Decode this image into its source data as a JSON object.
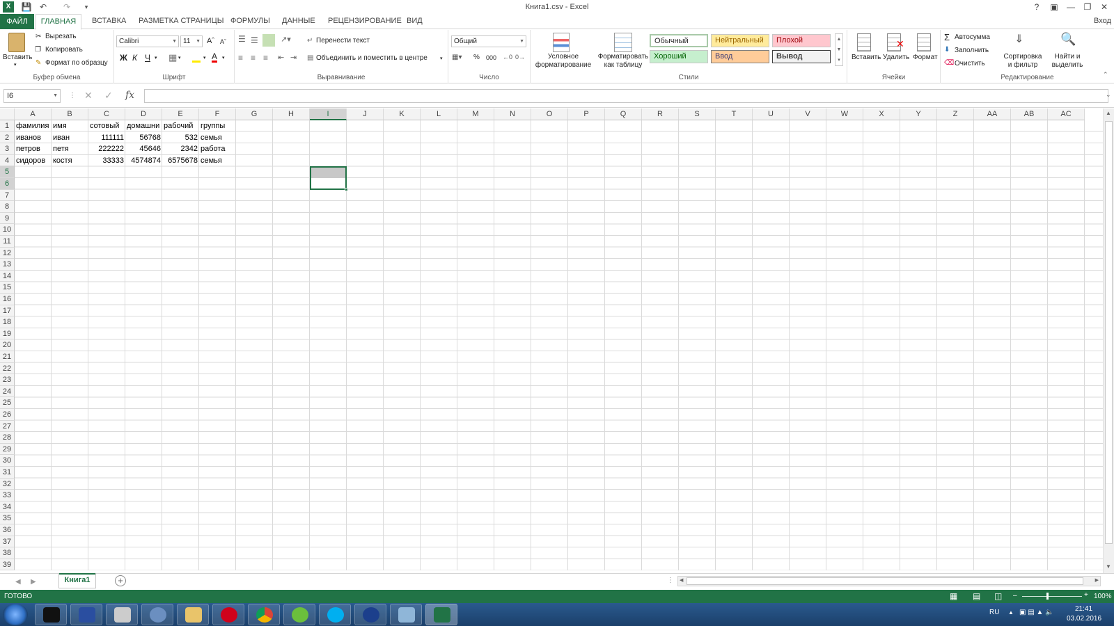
{
  "window": {
    "title": "Книга1.csv - Excel"
  },
  "ribbon_tabs": {
    "file": "ФАЙЛ",
    "items": [
      "ГЛАВНАЯ",
      "ВСТАВКА",
      "РАЗМЕТКА СТРАНИЦЫ",
      "ФОРМУЛЫ",
      "ДАННЫЕ",
      "РЕЦЕНЗИРОВАНИЕ",
      "ВИД"
    ],
    "signin": "Вход"
  },
  "clipboard": {
    "paste": "Вставить",
    "cut": "Вырезать",
    "copy": "Копировать",
    "format_painter": "Формат по образцу",
    "label": "Буфер обмена"
  },
  "font": {
    "name": "Calibri",
    "size": "11",
    "bold": "Ж",
    "italic": "К",
    "underline": "Ч",
    "label": "Шрифт"
  },
  "alignment": {
    "wrap": "Перенести текст",
    "merge": "Объединить и поместить в центре",
    "label": "Выравнивание"
  },
  "number": {
    "format": "Общий",
    "percent": "%",
    "thousands": "000",
    "label": "Число"
  },
  "styles": {
    "conditional": "Условное форматирование",
    "as_table": "Форматировать как таблицу",
    "label": "Стили",
    "normal": "Обычный",
    "neutral": "Нейтральный",
    "bad": "Плохой",
    "good": "Хороший",
    "input": "Ввод",
    "output": "Вывод"
  },
  "cells": {
    "insert": "Вставить",
    "delete": "Удалить",
    "format": "Формат",
    "label": "Ячейки"
  },
  "editing": {
    "autosum": "Автосумма",
    "fill": "Заполнить",
    "clear": "Очистить",
    "sort": "Сортировка и фильтр",
    "find": "Найти и выделить",
    "label": "Редактирование"
  },
  "formula_bar": {
    "name_box": "I6",
    "fx": "fx",
    "value": ""
  },
  "grid": {
    "columns": [
      "A",
      "B",
      "C",
      "D",
      "E",
      "F",
      "G",
      "H",
      "I",
      "J",
      "K",
      "L",
      "M",
      "N",
      "O",
      "P",
      "Q",
      "R",
      "S",
      "T",
      "U",
      "V",
      "W",
      "X",
      "Y",
      "Z",
      "AA",
      "AB",
      "AC"
    ],
    "rows": [
      "1",
      "2",
      "3",
      "4",
      "5",
      "6",
      "7",
      "8",
      "9",
      "10",
      "11",
      "12",
      "13",
      "14",
      "15",
      "16",
      "17",
      "18",
      "19",
      "20",
      "21",
      "22",
      "23",
      "24",
      "25",
      "26",
      "27",
      "28",
      "29",
      "30",
      "31",
      "32",
      "33",
      "34",
      "35",
      "36",
      "37",
      "38",
      "39"
    ],
    "data": [
      [
        "фамилия",
        "имя",
        "сотовый",
        "домашни",
        "рабочий",
        "группы"
      ],
      [
        "иванов",
        "иван",
        "111111",
        "56768",
        "532",
        "семья"
      ],
      [
        "петров",
        "петя",
        "222222",
        "45646",
        "2342",
        "работа"
      ],
      [
        "сидоров",
        "костя",
        "33333",
        "4574874",
        "6575678",
        "семья"
      ]
    ],
    "selected_cell": "I6"
  },
  "sheets": {
    "active": "Книга1"
  },
  "status_bar": {
    "ready": "ГОТОВО",
    "zoom": "100%"
  },
  "taskbar": {
    "lang": "RU",
    "time": "21:41",
    "date": "03.02.2016"
  },
  "colors": {
    "accent": "#217346",
    "taskbar": "#1f4a7a"
  }
}
